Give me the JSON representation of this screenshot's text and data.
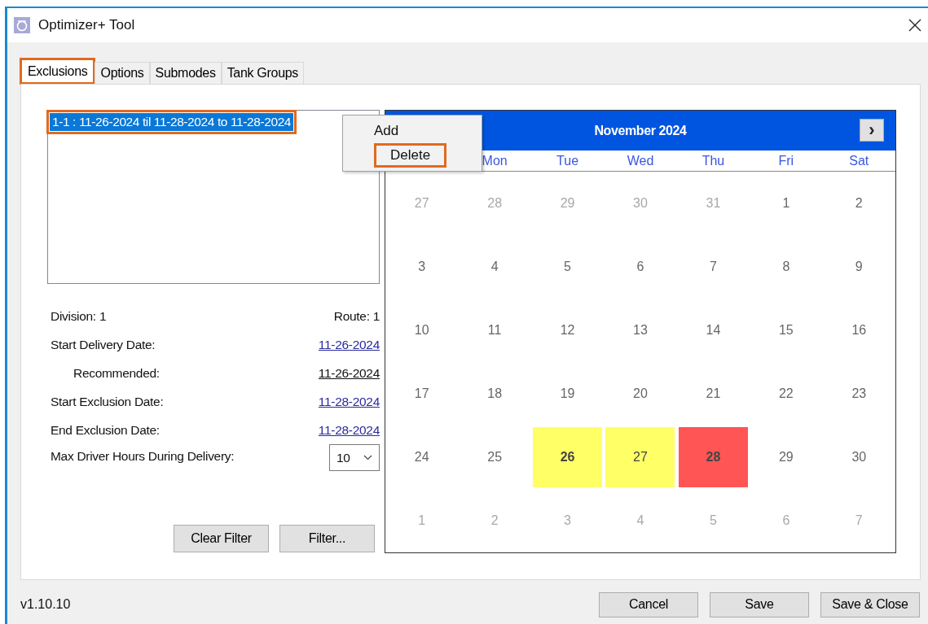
{
  "window": {
    "title": "Optimizer+ Tool"
  },
  "tabs": [
    {
      "label": "Exclusions",
      "selected": true,
      "highlighted": true
    },
    {
      "label": "Options",
      "selected": false,
      "highlighted": false
    },
    {
      "label": "Submodes",
      "selected": false,
      "highlighted": false
    },
    {
      "label": "Tank Groups",
      "selected": false,
      "highlighted": false
    }
  ],
  "exclusion_list": [
    {
      "text": "1-1 : 11-26-2024 til 11-28-2024 to 11-28-2024",
      "selected": true,
      "highlighted": true
    }
  ],
  "context_menu": [
    {
      "label": "Add",
      "highlighted": false
    },
    {
      "label": "Delete",
      "highlighted": true
    }
  ],
  "division": "Division: 1",
  "route": "Route: 1",
  "fields": [
    {
      "label": "Start Delivery Date:",
      "value": "11-26-2024",
      "link": true,
      "indented": false
    },
    {
      "label": "Recommended:",
      "value": "11-26-2024",
      "link": false,
      "indented": true
    },
    {
      "label": "Start Exclusion Date:",
      "value": "11-28-2024",
      "link": true,
      "indented": false
    },
    {
      "label": "End Exclusion Date:",
      "value": "11-28-2024",
      "link": true,
      "indented": false
    }
  ],
  "max_hours": {
    "label": "Max Driver Hours During Delivery:",
    "value": "10"
  },
  "filter_buttons": [
    "Clear Filter",
    "Filter..."
  ],
  "calendar": {
    "title": "November 2024",
    "next": "›",
    "weekdays": [
      "Mon",
      "Tue",
      "Wed",
      "Thu",
      "Fri",
      "Sat"
    ],
    "days": [
      {
        "text": "27",
        "kind": "other"
      },
      {
        "text": "28",
        "kind": "other"
      },
      {
        "text": "29",
        "kind": "other"
      },
      {
        "text": "30",
        "kind": "other"
      },
      {
        "text": "31",
        "kind": "other"
      },
      {
        "text": "1",
        "kind": "current"
      },
      {
        "text": "2",
        "kind": "current"
      },
      {
        "text": "3",
        "kind": "current"
      },
      {
        "text": "4",
        "kind": "current"
      },
      {
        "text": "5",
        "kind": "current"
      },
      {
        "text": "6",
        "kind": "current"
      },
      {
        "text": "7",
        "kind": "current"
      },
      {
        "text": "8",
        "kind": "current"
      },
      {
        "text": "9",
        "kind": "current"
      },
      {
        "text": "10",
        "kind": "current"
      },
      {
        "text": "11",
        "kind": "current"
      },
      {
        "text": "12",
        "kind": "current"
      },
      {
        "text": "13",
        "kind": "current"
      },
      {
        "text": "14",
        "kind": "current"
      },
      {
        "text": "15",
        "kind": "current"
      },
      {
        "text": "16",
        "kind": "current"
      },
      {
        "text": "17",
        "kind": "current"
      },
      {
        "text": "18",
        "kind": "current"
      },
      {
        "text": "19",
        "kind": "current"
      },
      {
        "text": "20",
        "kind": "current"
      },
      {
        "text": "21",
        "kind": "current"
      },
      {
        "text": "22",
        "kind": "current"
      },
      {
        "text": "23",
        "kind": "current"
      },
      {
        "text": "24",
        "kind": "current"
      },
      {
        "text": "25",
        "kind": "current"
      },
      {
        "text": "26",
        "color": "#ffff66",
        "bold": true
      },
      {
        "text": "27",
        "color": "#ffff66",
        "bold": false
      },
      {
        "text": "28",
        "color": "#ff5555",
        "bold": true
      },
      {
        "text": "29",
        "kind": "current"
      },
      {
        "text": "30",
        "kind": "current"
      },
      {
        "text": "1",
        "kind": "other"
      },
      {
        "text": "2",
        "kind": "other"
      },
      {
        "text": "3",
        "kind": "other"
      },
      {
        "text": "4",
        "kind": "other"
      },
      {
        "text": "5",
        "kind": "other"
      },
      {
        "text": "6",
        "kind": "other"
      },
      {
        "text": "7",
        "kind": "other"
      }
    ]
  },
  "version": "v1.10.10",
  "footer_buttons": [
    "Cancel",
    "Save",
    "Save & Close"
  ]
}
